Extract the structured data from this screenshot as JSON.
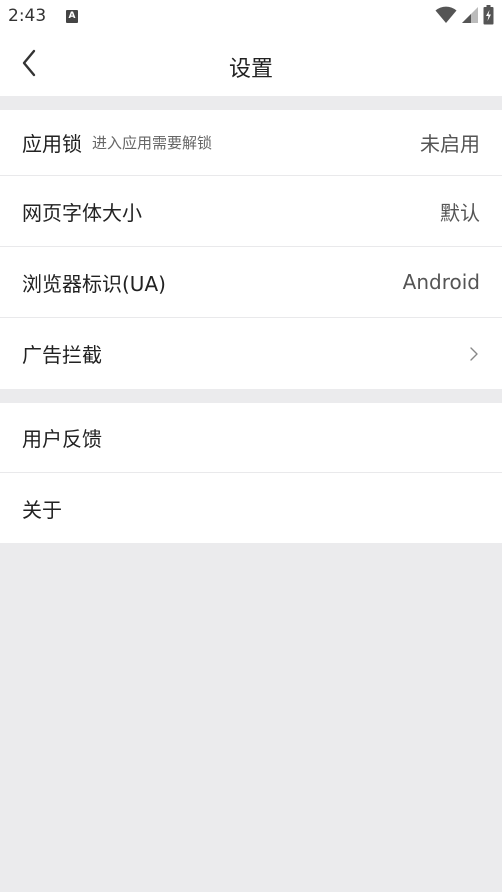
{
  "status_bar": {
    "time": "2:43",
    "notification_icon_letter": "A"
  },
  "header": {
    "title": "设置"
  },
  "settings_group_1": [
    {
      "label": "应用锁",
      "sublabel": "进入应用需要解锁",
      "value": "未启用"
    },
    {
      "label": "网页字体大小",
      "value": "默认"
    },
    {
      "label": "浏览器标识(UA)",
      "value": "Android"
    },
    {
      "label": "广告拦截",
      "value": ""
    }
  ],
  "settings_group_2": [
    {
      "label": "用户反馈"
    },
    {
      "label": "关于"
    }
  ],
  "colors": {
    "background": "#ebebed",
    "surface": "#ffffff",
    "divider": "#e9e9eb",
    "text_primary": "#222222",
    "text_secondary": "#555555"
  }
}
